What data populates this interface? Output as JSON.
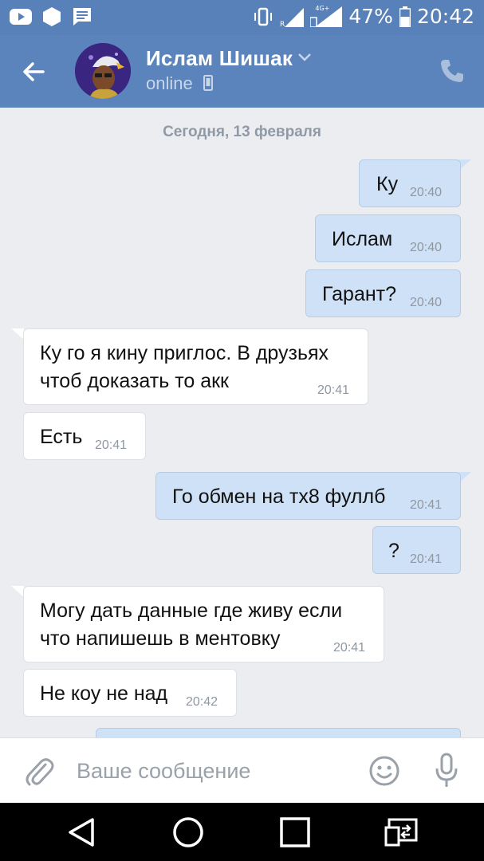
{
  "status_bar": {
    "battery": "47%",
    "time": "20:42",
    "network_badge": "4G+"
  },
  "header": {
    "contact_name": "Ислам Шишак",
    "status": "online"
  },
  "chat": {
    "date_separator": "Сегодня, 13 февраля",
    "messages": [
      {
        "direction": "out",
        "lines": [
          "Ку"
        ],
        "time": "20:40"
      },
      {
        "direction": "out",
        "lines": [
          "Ислам"
        ],
        "time": "20:40"
      },
      {
        "direction": "out",
        "lines": [
          "Гарант?"
        ],
        "time": "20:40"
      },
      {
        "direction": "in",
        "lines": [
          "Ку го я кину приглос. В друзьях",
          "чтоб доказать то акк"
        ],
        "time": "20:41"
      },
      {
        "direction": "in",
        "lines": [
          "Есть"
        ],
        "time": "20:41"
      },
      {
        "direction": "out",
        "lines": [
          "Го обмен на тх8 фуллб"
        ],
        "time": "20:41"
      },
      {
        "direction": "out",
        "lines": [
          "?"
        ],
        "time": "20:41"
      },
      {
        "direction": "in",
        "lines": [
          "Могу дать данные где живу если",
          "что напишешь в ментовку"
        ],
        "time": "20:41"
      },
      {
        "direction": "in",
        "lines": [
          "Не коу не над"
        ],
        "time": "20:42"
      }
    ]
  },
  "composer": {
    "placeholder": "Ваше сообщение",
    "value": ""
  },
  "colors": {
    "header": "#5a84bb",
    "status_bar": "#5781b8",
    "chat_bg": "#ebedf0",
    "bubble_out": "#cfe1f6",
    "bubble_in": "#ffffff",
    "icon_gray": "#9aa1a9"
  },
  "icons": {
    "status_left": [
      "youtube-icon",
      "hexagon-app-icon",
      "message-icon"
    ],
    "status_right": [
      "vibrate-icon",
      "signal-icon",
      "signal-4g-icon",
      "battery-icon"
    ],
    "header": [
      "back-arrow-icon",
      "chevron-down-icon",
      "mobile-phone-icon",
      "phone-call-icon"
    ],
    "composer": [
      "paperclip-icon",
      "emoji-icon",
      "microphone-icon"
    ],
    "nav": [
      "nav-back-icon",
      "nav-home-icon",
      "nav-recents-icon",
      "screen-mirror-icon"
    ]
  }
}
